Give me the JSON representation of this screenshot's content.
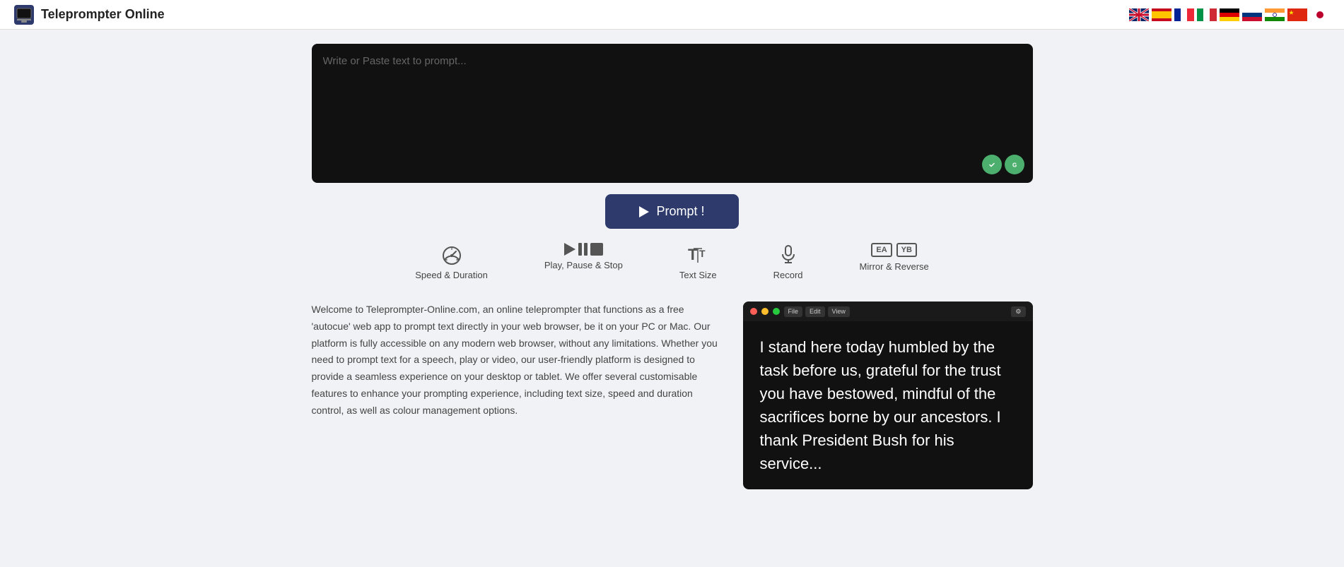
{
  "header": {
    "title": "Teleprompter Online",
    "logo_alt": "teleprompter-logo"
  },
  "flags": [
    {
      "name": "uk-flag",
      "color": "#012169",
      "label": "EN"
    },
    {
      "name": "es-flag",
      "color": "#c60b1e",
      "label": "ES"
    },
    {
      "name": "fr-flag",
      "color": "#002395",
      "label": "FR"
    },
    {
      "name": "it-flag",
      "color": "#009246",
      "label": "IT"
    },
    {
      "name": "de-flag",
      "color": "#000",
      "label": "DE"
    },
    {
      "name": "ru-flag",
      "color": "#003580",
      "label": "RU"
    },
    {
      "name": "in-flag",
      "color": "#ff9933",
      "label": "IN"
    },
    {
      "name": "cn-flag",
      "color": "#de2910",
      "label": "CN"
    },
    {
      "name": "jp-flag",
      "color": "#bc002d",
      "label": "JP"
    }
  ],
  "textarea": {
    "placeholder": "Write or Paste text to prompt..."
  },
  "prompt_button": {
    "label": "Prompt !"
  },
  "controls": [
    {
      "name": "speed-duration",
      "label": "Speed & Duration"
    },
    {
      "name": "play-pause-stop",
      "label": "Play, Pause & Stop"
    },
    {
      "name": "text-size",
      "label": "Text Size"
    },
    {
      "name": "record",
      "label": "Record"
    },
    {
      "name": "mirror-reverse",
      "label": "Mirror & Reverse"
    }
  ],
  "mirror_labels": [
    "EA",
    "YB"
  ],
  "description": "Welcome to Teleprompter-Online.com, an online teleprompter that functions as a free 'autocue' web app to prompt text directly in your web browser, be it on your PC or Mac. Our platform is fully accessible on any modern web browser, without any limitations. Whether you need to prompt text for a speech, play or video, our user-friendly platform is designed to provide a seamless experience on your desktop or tablet. We offer several customisable features to enhance your prompting experience, including text size, speed and duration control, as well as colour management options.",
  "preview": {
    "text": "I stand here today humbled by the task before us, grateful for the trust you have bestowed, mindful of the sacrifices borne by our ancestors. I thank President Bush for his service...",
    "toolbar_items": [
      "File",
      "Edit",
      "View",
      "Settings"
    ]
  }
}
